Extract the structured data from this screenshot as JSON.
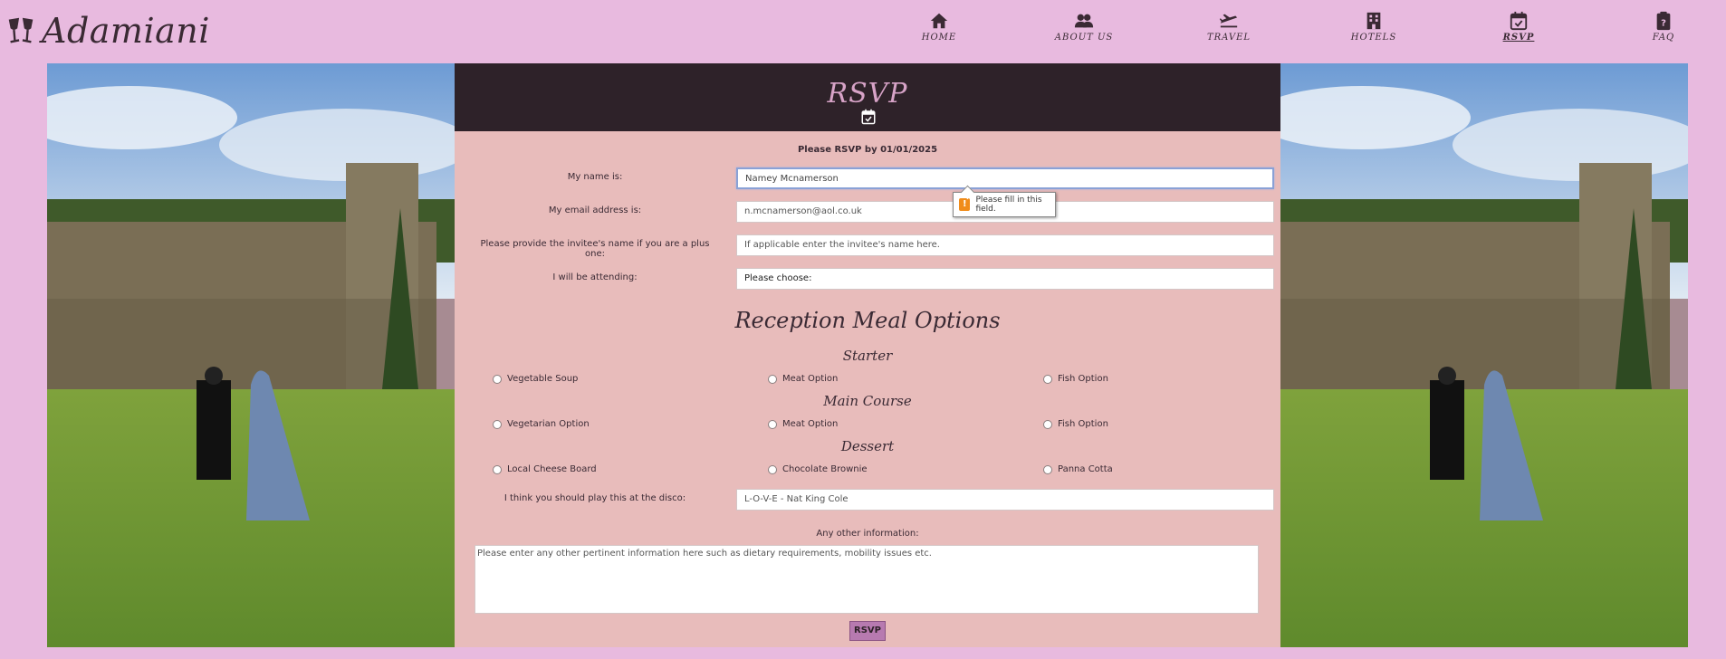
{
  "brand": {
    "name": "Adamiani"
  },
  "nav": [
    {
      "label": "HOME",
      "icon": "home-icon"
    },
    {
      "label": "ABOUT US",
      "icon": "users-icon"
    },
    {
      "label": "TRAVEL",
      "icon": "plane-icon"
    },
    {
      "label": "HOTELS",
      "icon": "hotel-icon"
    },
    {
      "label": "RSVP",
      "icon": "calendar-check-icon",
      "active": true
    },
    {
      "label": "FAQ",
      "icon": "clipboard-question-icon"
    }
  ],
  "rsvp": {
    "title": "RSVP",
    "deadline": "Please RSVP by 01/01/2025",
    "name_label": "My name is:",
    "name_placeholder": "Namey Mcnamerson",
    "email_label": "My email address is:",
    "email_placeholder": "n.mcnamerson@aol.co.uk",
    "invitee_label": "Please provide the invitee's name if you are a plus one:",
    "invitee_placeholder": "If applicable enter the invitee's name here.",
    "attending_label": "I will be attending:",
    "attending_value": "Please choose:",
    "tooltip": "Please fill in this field.",
    "meal_title": "Reception Meal Options",
    "starter": {
      "title": "Starter",
      "options": [
        "Vegetable Soup",
        "Meat Option",
        "Fish Option"
      ]
    },
    "main": {
      "title": "Main Course",
      "options": [
        "Vegetarian Option",
        "Meat Option",
        "Fish Option"
      ]
    },
    "dessert": {
      "title": "Dessert",
      "options": [
        "Local Cheese Board",
        "Chocolate Brownie",
        "Panna Cotta"
      ]
    },
    "disco_label": "I think you should play this at the disco:",
    "disco_placeholder": "L-O-V-E - Nat King Cole",
    "other_label": "Any other information:",
    "other_placeholder": "Please enter any other pertinent information here such as dietary requirements, mobility issues etc.",
    "submit": "RSVP"
  },
  "colors": {
    "background": "#e8badf",
    "panel": "#e8bcbb",
    "panel_header": "#2e2229",
    "accent": "#b77ab0"
  }
}
